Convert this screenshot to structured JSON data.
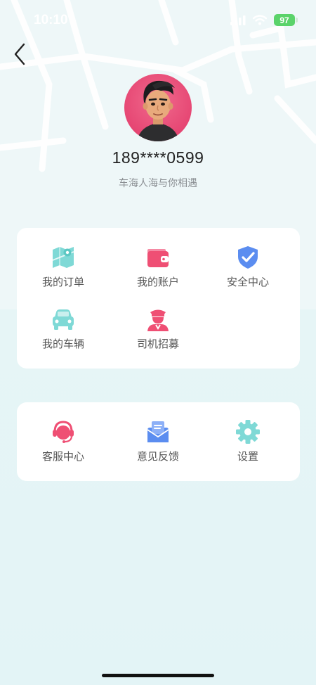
{
  "status_bar": {
    "time": "10:10",
    "battery": "97"
  },
  "profile": {
    "phone": "189****0599",
    "tagline": "车海人海与你相遇"
  },
  "menu_main": [
    {
      "label": "我的订单",
      "icon": "map-order-icon",
      "color": "#7fd9d6"
    },
    {
      "label": "我的账户",
      "icon": "wallet-icon",
      "color": "#ef4f74"
    },
    {
      "label": "安全中心",
      "icon": "shield-check-icon",
      "color": "#5b8df0"
    },
    {
      "label": "我的车辆",
      "icon": "car-icon",
      "color": "#7fd9d6"
    },
    {
      "label": "司机招募",
      "icon": "driver-icon",
      "color": "#ef4f74"
    }
  ],
  "menu_service": [
    {
      "label": "客服中心",
      "icon": "headset-icon",
      "color": "#ef4f74"
    },
    {
      "label": "意见反馈",
      "icon": "feedback-mail-icon",
      "color": "#5b8df0"
    },
    {
      "label": "设置",
      "icon": "settings-gear-icon",
      "color": "#7fd9d6"
    }
  ],
  "colors": {
    "accent_teal": "#7fd9d6",
    "accent_pink": "#ef4f74",
    "accent_blue": "#5b8df0"
  }
}
